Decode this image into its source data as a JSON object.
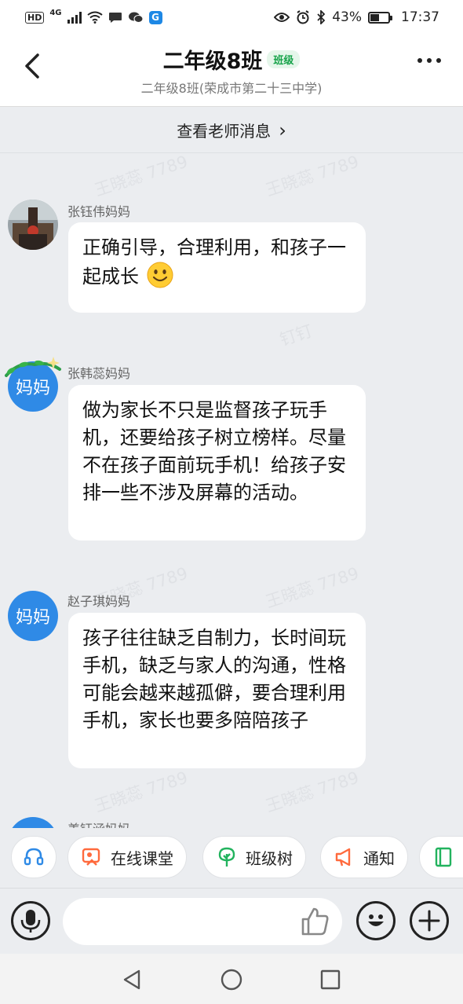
{
  "status_bar": {
    "hd_label": "HD",
    "network": "4G",
    "battery_percent": "43%",
    "time": "17:37",
    "app_icon_glyph": "G",
    "icons": [
      "hd-icon",
      "signal-icon",
      "wifi-icon",
      "chat-bubble-icon",
      "wechat-icon",
      "app-icon",
      "eye-icon",
      "alarm-icon",
      "bluetooth-icon",
      "battery-icon"
    ]
  },
  "header": {
    "title": "二年级8班",
    "badge": "班级",
    "subtitle": "二年级8班(荣成市第二十三中学)"
  },
  "teacher_link": {
    "label": "查看老师消息",
    "chevron": "›"
  },
  "watermark": {
    "name_text": "王晓蕊 7789",
    "app_text": "钉钉"
  },
  "messages": [
    {
      "sender": "张钰伟妈妈",
      "avatar_type": "photo",
      "avatar_label": "",
      "text": "正确引导，合理利用，和孩子一起成长",
      "emoji": "smile-emoji"
    },
    {
      "sender": "张韩蕊妈妈",
      "avatar_type": "text",
      "avatar_label": "妈妈",
      "decoration": "wreath",
      "text": "做为家长不只是监督孩子玩手机，还要给孩子树立榜样。尽量不在孩子面前玩手机！给孩子安排一些不涉及屏幕的活动。"
    },
    {
      "sender": "赵子琪妈妈",
      "avatar_type": "text",
      "avatar_label": "妈妈",
      "text": "孩子往往缺乏自制力，长时间玩手机，缺乏与家人的沟通，性格可能会越来越孤僻，要合理利用手机，家长也要多陪陪孩子"
    },
    {
      "sender": "姜钰涵妈妈",
      "avatar_type": "text",
      "avatar_label": "",
      "text": ""
    }
  ],
  "quick_actions": {
    "items": [
      {
        "label": "",
        "icon": "headset-icon",
        "color": "#2f8ae6"
      },
      {
        "label": "在线课堂",
        "icon": "online-class-icon",
        "color": "#ff6a3d"
      },
      {
        "label": "班级树",
        "icon": "tree-icon",
        "color": "#22b35e"
      },
      {
        "label": "通知",
        "icon": "megaphone-icon",
        "color": "#ff6a3d"
      },
      {
        "label": "",
        "icon": "notebook-icon",
        "color": "#22b35e"
      }
    ]
  },
  "input_bar": {
    "placeholder": "",
    "icons": [
      "microphone-icon",
      "thumbs-up-icon",
      "emoji-icon",
      "plus-icon"
    ]
  },
  "nav_bar": {
    "icons": [
      "nav-back-icon",
      "nav-home-icon",
      "nav-recents-icon"
    ]
  },
  "colors": {
    "accent_blue": "#2f8ae6",
    "badge_green": "#17a34a",
    "chat_background": "#ebedf0"
  }
}
